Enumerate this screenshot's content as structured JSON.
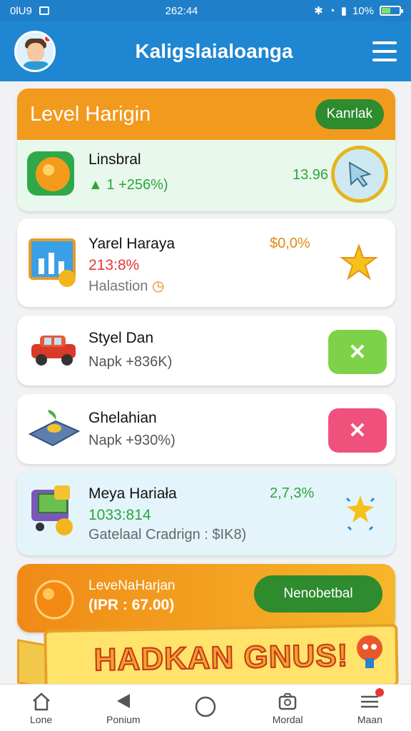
{
  "status_bar": {
    "left_text": "0lU9",
    "time": "262:44",
    "battery": "10%"
  },
  "header": {
    "title": "Kaligslaialoanga"
  },
  "level_card": {
    "title": "Level Harigin",
    "button_label": "Kanrlak",
    "row": {
      "title": "Linsbral",
      "sub": "1 +256%)",
      "value": "13.96"
    }
  },
  "items": [
    {
      "title": "Yarel Haraya",
      "line2": "213:8%",
      "line3": "Halastion",
      "value": "$0,0%"
    },
    {
      "title": "Styel Dan",
      "line2": "Napk +836K)",
      "button_glyph": "✕"
    },
    {
      "title": "Ghelahian",
      "line2": "Napk +930%)",
      "button_glyph": "✕"
    },
    {
      "title": "Meya Hariała",
      "line2": "1033:814",
      "line3": "Gatelaal Cradrign : $IK8)",
      "value": "2,7,3%"
    }
  ],
  "promo": {
    "title": "LeveNaHarjan",
    "sub": "(IPR : 67.00)",
    "button_label": "Nenobetbal"
  },
  "banner": {
    "text": "HADKAN GNUS!"
  },
  "bottom_nav": [
    {
      "label": "Lone",
      "icon": "home-icon"
    },
    {
      "label": "Ponium",
      "icon": "back-icon"
    },
    {
      "label": "",
      "icon": "circle-home-icon"
    },
    {
      "label": "Mordal",
      "icon": "camera-icon"
    },
    {
      "label": "Maan",
      "icon": "menu-icon"
    }
  ],
  "colors": {
    "header": "#1f86d1",
    "accent_orange": "#f29a1e",
    "accent_green": "#2e8b2e",
    "success_btn": "#7dd24a",
    "danger_btn": "#f0507c"
  }
}
